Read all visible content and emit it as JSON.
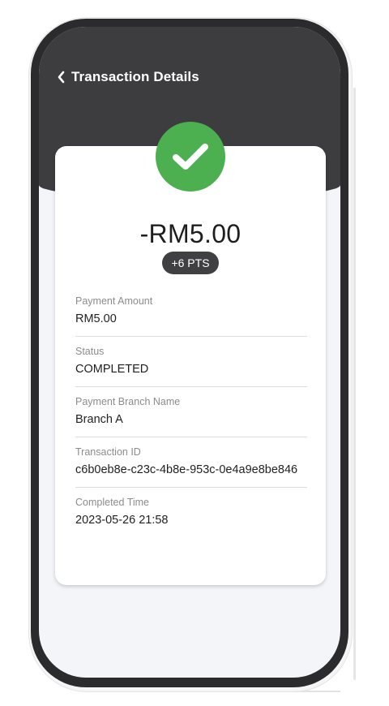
{
  "header": {
    "title": "Transaction Details"
  },
  "icons": {
    "back": "chevron-left-icon",
    "status": "check-circle-icon"
  },
  "colors": {
    "header_bg": "#3d3d40",
    "success": "#4caf50",
    "badge_bg": "#404042"
  },
  "summary": {
    "amount": "-RM5.00",
    "points": "+6 PTS"
  },
  "details": [
    {
      "label": "Payment Amount",
      "value": "RM5.00"
    },
    {
      "label": "Status",
      "value": "COMPLETED"
    },
    {
      "label": "Payment Branch Name",
      "value": "Branch A"
    },
    {
      "label": "Transaction ID",
      "value": "c6b0eb8e-c23c-4b8e-953c-0e4a9e8be846"
    },
    {
      "label": "Completed Time",
      "value": "2023-05-26 21:58"
    }
  ]
}
